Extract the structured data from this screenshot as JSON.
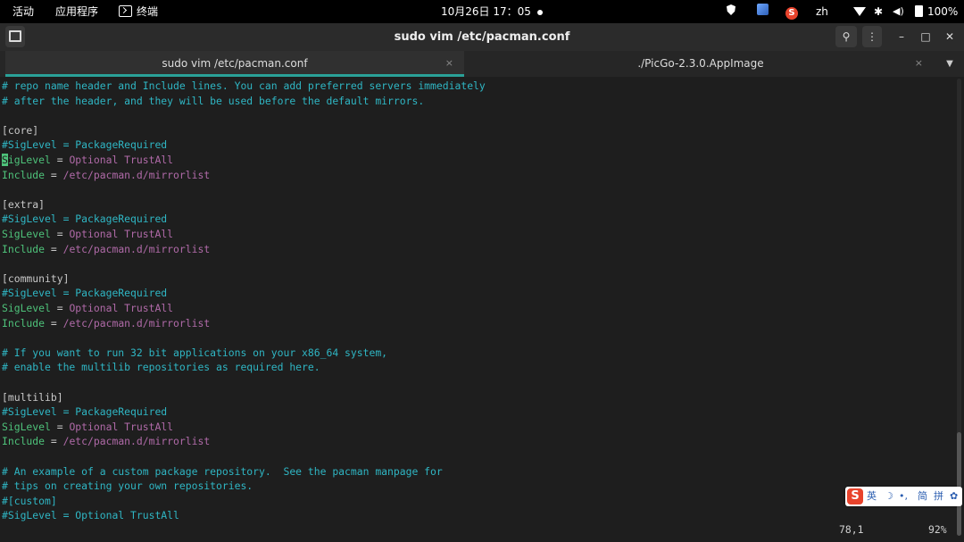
{
  "topbar": {
    "activities": "活动",
    "apps_menu": "应用程序",
    "terminal_app": "终端",
    "clock": "10月26日  17：05",
    "sogou_badge": "S",
    "input_lang": "zh",
    "battery_pct": "100%",
    "icons": [
      "shield-icon",
      "image-app-icon",
      "sogou-icon",
      "wifi-icon",
      "bluetooth-icon",
      "volume-icon",
      "battery-icon"
    ]
  },
  "window": {
    "title": "sudo vim /etc/pacman.conf",
    "buttons": [
      "new-tab",
      "search",
      "menu",
      "minimize",
      "maximize",
      "close"
    ]
  },
  "tabs": [
    {
      "label": "sudo vim /etc/pacman.conf",
      "active": true,
      "close": "×"
    },
    {
      "label": "./PicGo-2.3.0.AppImage",
      "active": false,
      "close": "×"
    }
  ],
  "vim": {
    "lines": [
      {
        "t": "comment",
        "text": "# repo name header and Include lines. You can add preferred servers immediately"
      },
      {
        "t": "comment",
        "text": "# after the header, and they will be used before the default mirrors."
      },
      {
        "t": "blank",
        "text": ""
      },
      {
        "t": "section",
        "text": "[core]"
      },
      {
        "t": "comment",
        "text": "#SigLevel = PackageRequired"
      },
      {
        "t": "kv",
        "key": "SigLevel",
        "eq": " = ",
        "val": "Optional TrustAll",
        "cursor": true
      },
      {
        "t": "kv",
        "key": "Include",
        "eq": " = ",
        "val": "/etc/pacman.d/mirrorlist"
      },
      {
        "t": "blank",
        "text": ""
      },
      {
        "t": "section",
        "text": "[extra]"
      },
      {
        "t": "comment",
        "text": "#SigLevel = PackageRequired"
      },
      {
        "t": "kv",
        "key": "SigLevel",
        "eq": " = ",
        "val": "Optional TrustAll"
      },
      {
        "t": "kv",
        "key": "Include",
        "eq": " = ",
        "val": "/etc/pacman.d/mirrorlist"
      },
      {
        "t": "blank",
        "text": ""
      },
      {
        "t": "section",
        "text": "[community]"
      },
      {
        "t": "comment",
        "text": "#SigLevel = PackageRequired"
      },
      {
        "t": "kv",
        "key": "SigLevel",
        "eq": " = ",
        "val": "Optional TrustAll"
      },
      {
        "t": "kv",
        "key": "Include",
        "eq": " = ",
        "val": "/etc/pacman.d/mirrorlist"
      },
      {
        "t": "blank",
        "text": ""
      },
      {
        "t": "comment",
        "text": "# If you want to run 32 bit applications on your x86_64 system,"
      },
      {
        "t": "comment",
        "text": "# enable the multilib repositories as required here."
      },
      {
        "t": "blank",
        "text": ""
      },
      {
        "t": "section",
        "text": "[multilib]"
      },
      {
        "t": "comment",
        "text": "#SigLevel = PackageRequired"
      },
      {
        "t": "kv",
        "key": "SigLevel",
        "eq": " = ",
        "val": "Optional TrustAll"
      },
      {
        "t": "kv",
        "key": "Include",
        "eq": " = ",
        "val": "/etc/pacman.d/mirrorlist"
      },
      {
        "t": "blank",
        "text": ""
      },
      {
        "t": "comment",
        "text": "# An example of a custom package repository.  See the pacman manpage for"
      },
      {
        "t": "comment",
        "text": "# tips on creating your own repositories."
      },
      {
        "t": "comment",
        "text": "#[custom]"
      },
      {
        "t": "comment",
        "text": "#SigLevel = Optional TrustAll"
      }
    ],
    "ruler": "78,1",
    "percent": "92%"
  },
  "ime": {
    "logo": "S",
    "mode": "英",
    "moon": "☽",
    "punct": "•,",
    "simplified": "简",
    "pinyin": "拼",
    "settings": "✿"
  },
  "colors": {
    "comment": "#2fb6c4",
    "key": "#4ec27a",
    "value": "#b06aa8",
    "tab_accent": "#2aa198"
  }
}
